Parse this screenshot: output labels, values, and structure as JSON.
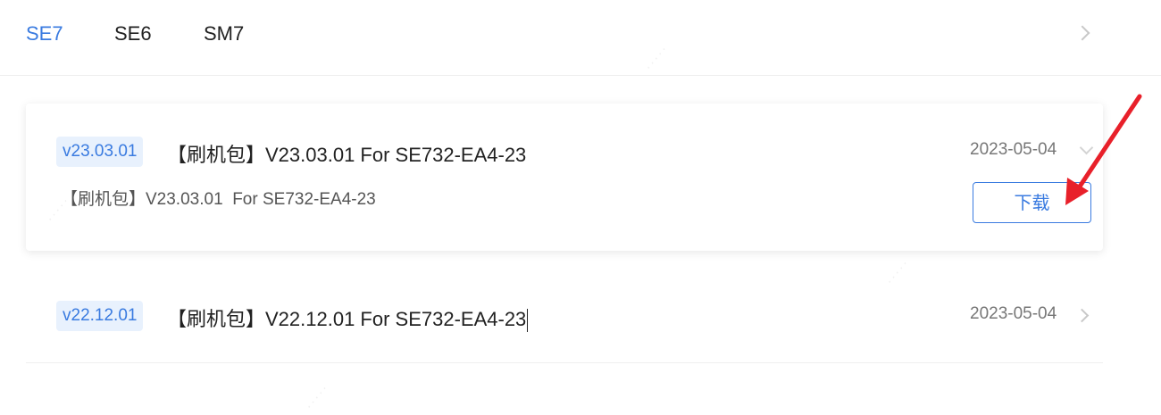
{
  "tabs": {
    "items": [
      {
        "label": "SE7",
        "active": true
      },
      {
        "label": "SE6",
        "active": false
      },
      {
        "label": "SM7",
        "active": false
      }
    ]
  },
  "releases": [
    {
      "version": "v23.03.01",
      "title": "【刷机包】V23.03.01 For SE732-EA4-23",
      "date": "2023-05-04",
      "description": "【刷机包】V23.03.01  For SE732-EA4-23",
      "download_label": "下载",
      "expanded": true
    },
    {
      "version": "v22.12.01",
      "title": "【刷机包】V22.12.01 For SE732-EA4-23",
      "date": "2023-05-04",
      "expanded": false
    }
  ],
  "colors": {
    "accent": "#3a7be0",
    "badge_bg": "#e8f1fd",
    "annotation": "#e8202a"
  },
  "icons": {
    "tabs_more": "chevron-right-icon",
    "expanded": "chevron-down-icon",
    "collapsed": "chevron-right-icon",
    "annotation": "red-arrow-icon"
  }
}
